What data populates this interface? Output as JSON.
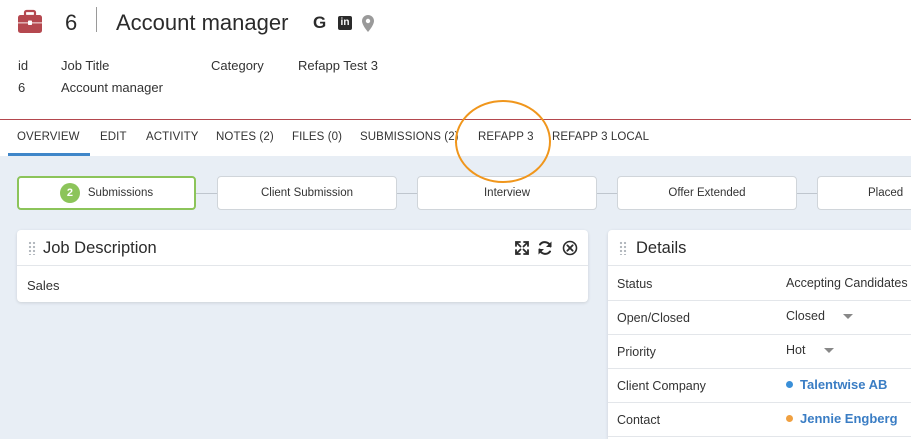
{
  "header": {
    "record_id": "6",
    "title": "Account manager",
    "google_icon_text": "G",
    "linkedin_icon_text": "in",
    "brand_color": "#b5484f",
    "meta": [
      {
        "label": "id",
        "value": "6"
      },
      {
        "label": "Job Title",
        "value": "Account manager"
      },
      {
        "label": "Category",
        "value": ""
      },
      {
        "label": "Refapp Test 3",
        "value": ""
      }
    ]
  },
  "tabs": [
    {
      "label": "OVERVIEW",
      "active": true
    },
    {
      "label": "EDIT"
    },
    {
      "label": "ACTIVITY"
    },
    {
      "label": "NOTES (2)"
    },
    {
      "label": "FILES (0)"
    },
    {
      "label": "SUBMISSIONS (2)"
    },
    {
      "label": "REFAPP 3"
    },
    {
      "label": "REFAPP 3 LOCAL"
    }
  ],
  "pipeline": {
    "active_count": "2",
    "stages": [
      "Submissions",
      "Client Submission",
      "Interview",
      "Offer Extended",
      "Placed"
    ],
    "active_color": "#8cc45a"
  },
  "job_description": {
    "title": "Job Description",
    "body": "Sales",
    "icons": [
      "expand-icon",
      "refresh-icon",
      "close-icon"
    ]
  },
  "details": {
    "title": "Details",
    "rows": [
      {
        "label": "Status",
        "value": "Accepting Candidates"
      },
      {
        "label": "Open/Closed",
        "value": "Closed"
      },
      {
        "label": "Priority",
        "value": "Hot"
      },
      {
        "label": "Client Company",
        "value": "Talentwise AB",
        "dot_color": "#3a8fd8"
      },
      {
        "label": "Contact",
        "value": "Jennie Engberg",
        "dot_color": "#f0a040"
      }
    ]
  },
  "colors": {
    "link": "#3a7dc4",
    "tab_underline": "#3f86c9",
    "annotation": "#f0961c",
    "background": "#e8eef5"
  }
}
